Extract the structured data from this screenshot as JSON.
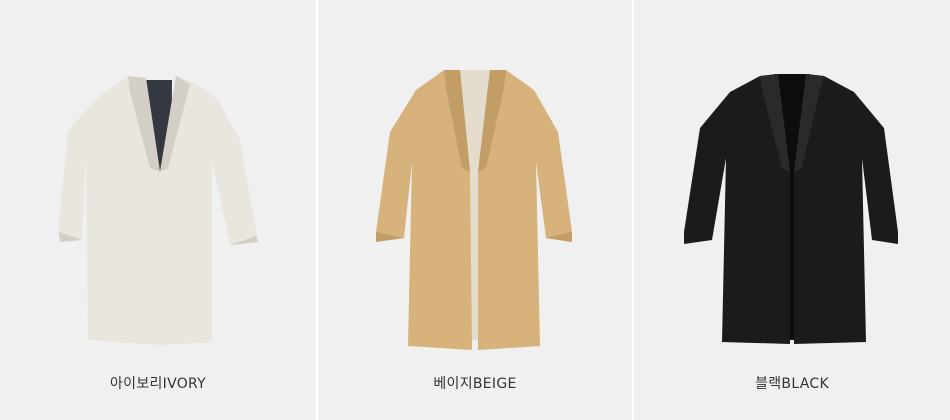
{
  "products": [
    {
      "label": "아이보리IVORY",
      "color_name": "ivory",
      "coat_color": "#e9e6df",
      "lining_color": "#343840",
      "shadow_color": "#d3cfc7"
    },
    {
      "label": "베이지BEIGE",
      "color_name": "beige",
      "coat_color": "#d7b27a",
      "lining_color": "#e4dccd",
      "shadow_color": "#c29d66"
    },
    {
      "label": "블랙BLACK",
      "color_name": "black",
      "coat_color": "#1b1b1d",
      "lining_color": "#0d0d0f",
      "shadow_color": "#2a2a2d"
    }
  ]
}
